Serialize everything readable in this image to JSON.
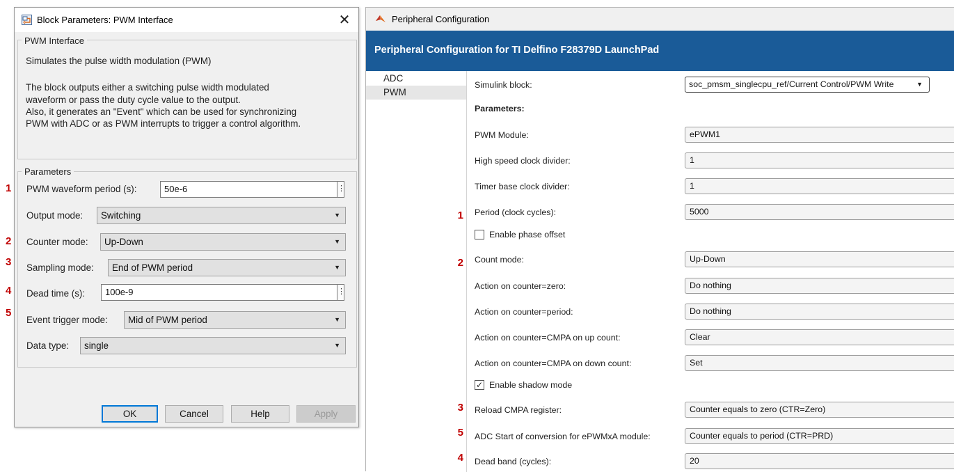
{
  "block_dialog": {
    "title": "Block Parameters: PWM Interface",
    "close_glyph": "✕",
    "block_name": "PWM Interface",
    "description": [
      "Simulates the pulse width modulation (PWM)",
      "",
      "The block outputs either a switching pulse width modulated",
      "waveform or pass the duty cycle value to the output.",
      "Also, it generates an \"Event\" which can be used for synchronizing",
      "PWM with ADC or as PWM interrupts to trigger a control algorithm."
    ],
    "parameters_heading": "Parameters",
    "params": {
      "pwm_period": {
        "label": "PWM waveform period (s):",
        "value": "50e-6",
        "marker": "1"
      },
      "output_mode": {
        "label": "Output mode:",
        "value": "Switching"
      },
      "counter_mode": {
        "label": "Counter mode:",
        "value": "Up-Down",
        "marker": "2"
      },
      "sampling_mode": {
        "label": "Sampling mode:",
        "value": "End of PWM period",
        "marker": "3"
      },
      "dead_time": {
        "label": "Dead time (s):",
        "value": "100e-9",
        "marker": "4"
      },
      "event_trigger": {
        "label": "Event trigger mode:",
        "value": "Mid of PWM period",
        "marker": "5"
      },
      "data_type": {
        "label": "Data type:",
        "value": "single"
      }
    },
    "buttons": {
      "ok": "OK",
      "cancel": "Cancel",
      "help": "Help",
      "apply": "Apply"
    },
    "kebab_glyph": "⋮",
    "dropdown_glyph": "▼"
  },
  "peripheral_window": {
    "title": "Peripheral Configuration",
    "banner": "Peripheral Configuration for TI Delfino F28379D LaunchPad",
    "nav": [
      "ADC",
      "PWM"
    ],
    "selected_nav": "PWM",
    "simulink_block": {
      "label": "Simulink block:",
      "value": "soc_pmsm_singlecpu_ref/Current Control/PWM Write"
    },
    "parameters_heading": "Parameters:",
    "fields": {
      "pwm_module": {
        "label": "PWM Module:",
        "value": "ePWM1"
      },
      "hs_clock_div": {
        "label": "High speed clock divider:",
        "value": "1"
      },
      "tb_clock_div": {
        "label": "Timer base clock divider:",
        "value": "1"
      },
      "period": {
        "label": "Period (clock cycles):",
        "value": "5000",
        "marker": "1"
      },
      "phase_offset": {
        "label": "Enable phase offset",
        "checked": false
      },
      "count_mode": {
        "label": "Count mode:",
        "value": "Up-Down",
        "marker": "2"
      },
      "act_zero": {
        "label": "Action on counter=zero:",
        "value": "Do nothing"
      },
      "act_period": {
        "label": "Action on counter=period:",
        "value": "Do nothing"
      },
      "act_cmpa_up": {
        "label": "Action on counter=CMPA on up count:",
        "value": "Clear"
      },
      "act_cmpa_down": {
        "label": "Action on counter=CMPA on down count:",
        "value": "Set"
      },
      "shadow_mode": {
        "label": "Enable shadow mode",
        "checked": true,
        "check_glyph": "✓"
      },
      "reload_cmpa": {
        "label": "Reload CMPA register:",
        "value": "Counter equals to zero (CTR=Zero)",
        "marker": "3"
      },
      "adc_soc": {
        "label": "ADC Start of conversion for ePWMxA module:",
        "value": "Counter equals to period (CTR=PRD)",
        "marker": "5"
      },
      "dead_band": {
        "label": "Dead band (cycles):",
        "value": "20",
        "marker": "4"
      }
    }
  },
  "colors": {
    "banner": "#1a5b98",
    "marker": "#c00000",
    "ok_focus": "#0078d7"
  }
}
